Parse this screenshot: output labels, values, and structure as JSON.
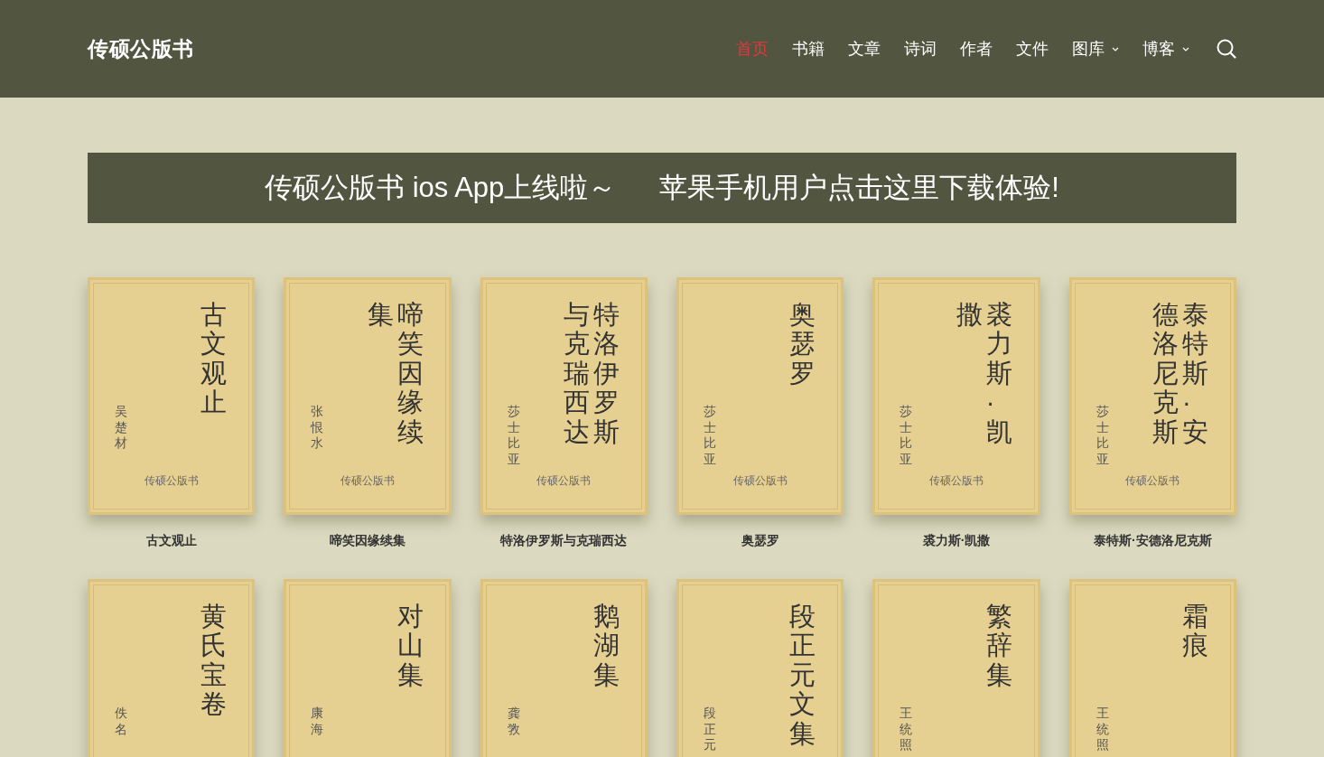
{
  "header": {
    "logo": "传硕公版书",
    "nav": [
      {
        "label": "首页",
        "selected": true,
        "dropdown": false
      },
      {
        "label": "书籍",
        "selected": false,
        "dropdown": false
      },
      {
        "label": "文章",
        "selected": false,
        "dropdown": false
      },
      {
        "label": "诗词",
        "selected": false,
        "dropdown": false
      },
      {
        "label": "作者",
        "selected": false,
        "dropdown": false
      },
      {
        "label": "文件",
        "selected": false,
        "dropdown": false
      },
      {
        "label": "图库",
        "selected": false,
        "dropdown": true
      },
      {
        "label": "博客",
        "selected": false,
        "dropdown": true
      }
    ]
  },
  "banner": {
    "parts": [
      "传硕公版书 ios App上线啦～",
      "苹果手机用户点击这里下载体验!"
    ]
  },
  "books": [
    {
      "cover_title_columns": [
        "古文观止"
      ],
      "cover_author": "吴楚材",
      "publisher": "传硕公版书",
      "caption": "古文观止"
    },
    {
      "cover_title_columns": [
        "集",
        "啼笑因缘续"
      ],
      "cover_author": "张恨水",
      "publisher": "传硕公版书",
      "caption": "啼笑因缘续集"
    },
    {
      "cover_title_columns": [
        "与克瑞西达",
        "特洛伊罗斯"
      ],
      "cover_author": "莎士比亚",
      "publisher": "传硕公版书",
      "caption": "特洛伊罗斯与克瑞西达"
    },
    {
      "cover_title_columns": [
        "奥瑟罗"
      ],
      "cover_author": "莎士比亚",
      "publisher": "传硕公版书",
      "caption": "奥瑟罗"
    },
    {
      "cover_title_columns": [
        "撒",
        "裘力斯·凯"
      ],
      "cover_author": "莎士比亚",
      "publisher": "传硕公版书",
      "caption": "裘力斯·凯撒"
    },
    {
      "cover_title_columns": [
        "德洛尼克斯",
        "泰特斯·安"
      ],
      "cover_author": "莎士比亚",
      "publisher": "传硕公版书",
      "caption": "泰特斯·安德洛尼克斯"
    },
    {
      "cover_title_columns": [
        "黄氏宝卷"
      ],
      "cover_author": "佚名"
    },
    {
      "cover_title_columns": [
        "对山集"
      ],
      "cover_author": "康海"
    },
    {
      "cover_title_columns": [
        "鹅湖集"
      ],
      "cover_author": "龚敩"
    },
    {
      "cover_title_columns": [
        "段正元文集"
      ],
      "cover_author": "段正元"
    },
    {
      "cover_title_columns": [
        "繁辞集"
      ],
      "cover_author": "王统照"
    },
    {
      "cover_title_columns": [
        "霜痕"
      ],
      "cover_author": "王统照"
    }
  ]
}
